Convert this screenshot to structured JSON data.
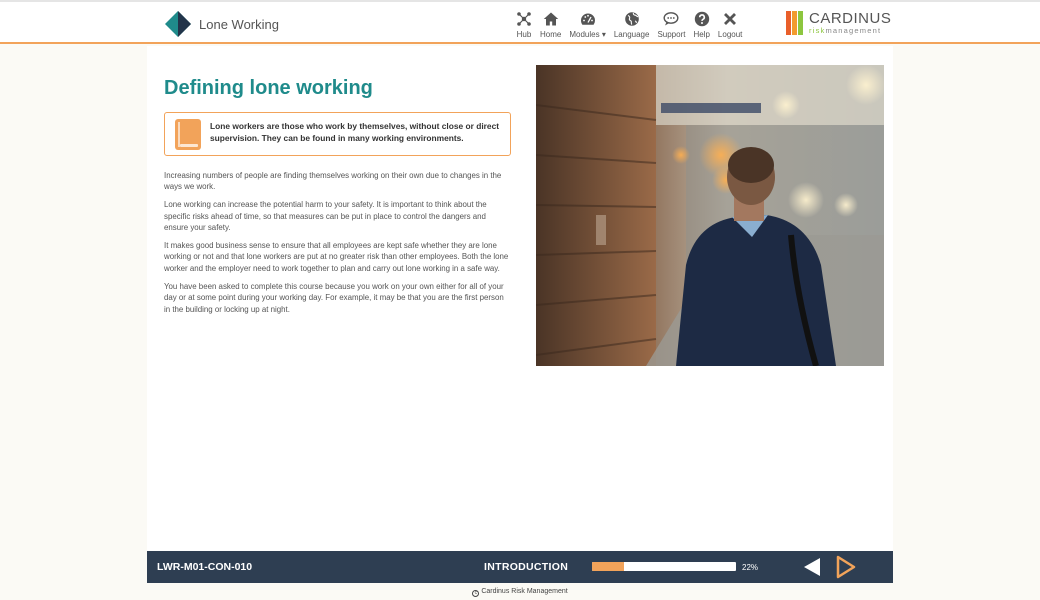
{
  "header": {
    "course_title": "Lone Working",
    "nav": [
      {
        "label": "Hub",
        "icon": "hub-icon"
      },
      {
        "label": "Home",
        "icon": "home-icon"
      },
      {
        "label": "Modules",
        "icon": "dashboard-icon"
      },
      {
        "label": "Language",
        "icon": "globe-icon"
      },
      {
        "label": "Support",
        "icon": "chat-icon"
      },
      {
        "label": "Help",
        "icon": "help-icon"
      },
      {
        "label": "Logout",
        "icon": "close-icon"
      }
    ],
    "modules_caret": "▾",
    "brand_name": "CARDINUS",
    "brand_sub_a": "risk",
    "brand_sub_b": "management"
  },
  "content": {
    "title": "Defining lone working",
    "callout": "Lone workers are those who work by themselves, without close or direct supervision. They can be found in many working environments.",
    "paragraphs": [
      "Increasing numbers of people are finding themselves working on their own due to changes in the ways we work.",
      "Lone working can increase the potential harm to your safety. It is important to think about the specific risks ahead of time, so that measures can be put in place to control the dangers and ensure your safety.",
      "It makes good business sense to ensure that all employees are kept safe whether they are lone working or not and that lone workers are put at no greater risk than other employees. Both the lone worker and the employer need to work together to plan and carry out lone working in a safe way.",
      "You have been asked to complete this course because you work on your own either for all of your day or at some point during your working day. For example, it may be that you are the first person in the building or locking up at night."
    ]
  },
  "footer": {
    "page_code": "LWR-M01-CON-010",
    "section": "INTRODUCTION",
    "progress": 22,
    "progress_label": "22%"
  },
  "copyright": "Cardinus Risk Management",
  "colors": {
    "accent_teal": "#1f8b8b",
    "accent_orange": "#f2a35a",
    "footer_bg": "#2e3e52"
  }
}
